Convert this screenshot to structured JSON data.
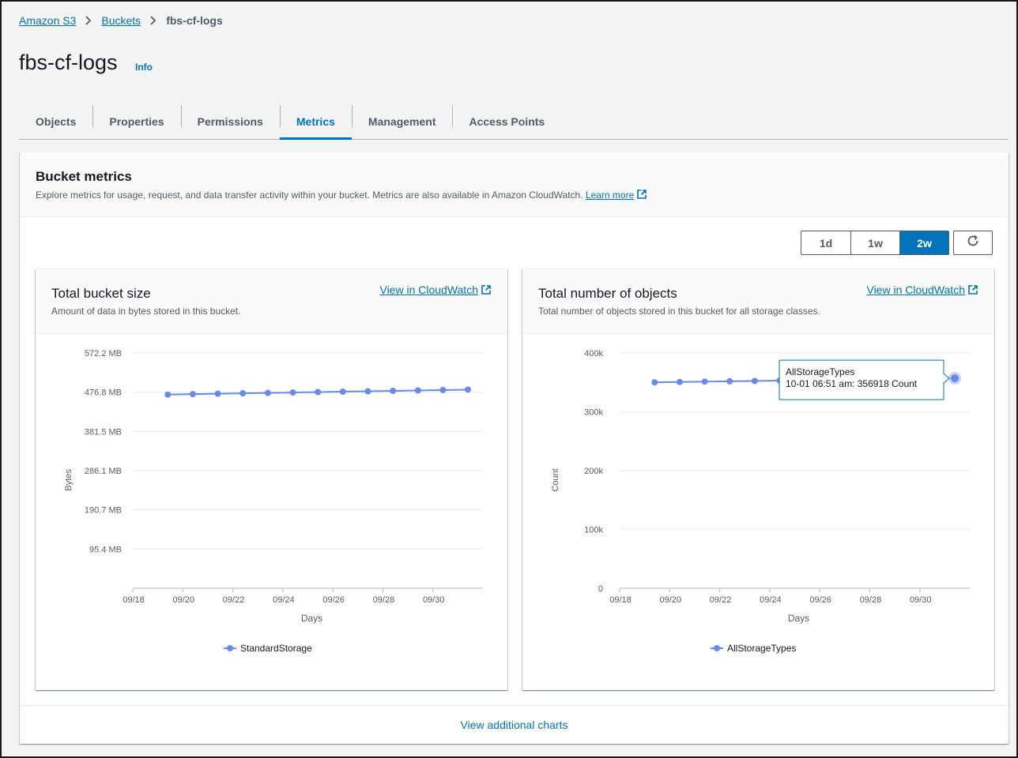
{
  "breadcrumb": {
    "root": "Amazon S3",
    "buckets": "Buckets",
    "current": "fbs-cf-logs"
  },
  "page": {
    "title": "fbs-cf-logs",
    "info": "Info"
  },
  "tabs": [
    {
      "label": "Objects"
    },
    {
      "label": "Properties"
    },
    {
      "label": "Permissions"
    },
    {
      "label": "Metrics",
      "active": true
    },
    {
      "label": "Management"
    },
    {
      "label": "Access Points"
    }
  ],
  "metrics": {
    "title": "Bucket metrics",
    "description": "Explore metrics for usage, request, and data transfer activity within your bucket. Metrics are also available in Amazon CloudWatch.",
    "learn_more": "Learn more",
    "ranges": [
      "1d",
      "1w",
      "2w"
    ],
    "active_range": "2w",
    "refresh_icon": "refresh-icon",
    "view_additional": "View additional charts"
  },
  "colors": {
    "accent": "#0073bb",
    "series": "#688ae8"
  },
  "chart_data": [
    {
      "type": "line",
      "title": "Total bucket size",
      "subtitle": "Amount of data in bytes stored in this bucket.",
      "link": "View in CloudWatch",
      "xlabel": "Days",
      "ylabel": "Bytes",
      "x_ticks": [
        "09/18",
        "09/20",
        "09/22",
        "09/24",
        "09/26",
        "09/28",
        "09/30"
      ],
      "y_ticks": [
        "572.2 MB",
        "476.8 MB",
        "381.5 MB",
        "286.1 MB",
        "190.7 MB",
        "95.4 MB"
      ],
      "ylim_mb": [
        0,
        572.2
      ],
      "series": [
        {
          "name": "StandardStorage",
          "x": [
            "09/19",
            "09/20",
            "09/21",
            "09/22",
            "09/23",
            "09/24",
            "09/25",
            "09/26",
            "09/27",
            "09/28",
            "09/29",
            "09/30",
            "10/01"
          ],
          "values_mb": [
            471,
            472,
            473,
            474,
            475,
            476,
            477,
            478,
            479,
            480,
            481,
            482,
            483
          ]
        }
      ]
    },
    {
      "type": "line",
      "title": "Total number of objects",
      "subtitle": "Total number of objects stored in this bucket for all storage classes.",
      "link": "View in CloudWatch",
      "xlabel": "Days",
      "ylabel": "Count",
      "x_ticks": [
        "09/18",
        "09/20",
        "09/22",
        "09/24",
        "09/26",
        "09/28",
        "09/30"
      ],
      "y_ticks": [
        "400k",
        "300k",
        "200k",
        "100k",
        "0"
      ],
      "ylim": [
        0,
        400000
      ],
      "series": [
        {
          "name": "AllStorageTypes",
          "x": [
            "09/19",
            "09/20",
            "09/21",
            "09/22",
            "09/23",
            "09/24",
            "09/25",
            "09/26",
            "09/27",
            "09/28",
            "09/29",
            "09/30",
            "10/01"
          ],
          "values": [
            350000,
            350600,
            351200,
            351800,
            352400,
            353000,
            353600,
            354200,
            354800,
            355300,
            355800,
            356300,
            356918
          ]
        }
      ],
      "tooltip": {
        "series": "AllStorageTypes",
        "text": "10-01 06:51 am: 356918 Count"
      }
    }
  ]
}
